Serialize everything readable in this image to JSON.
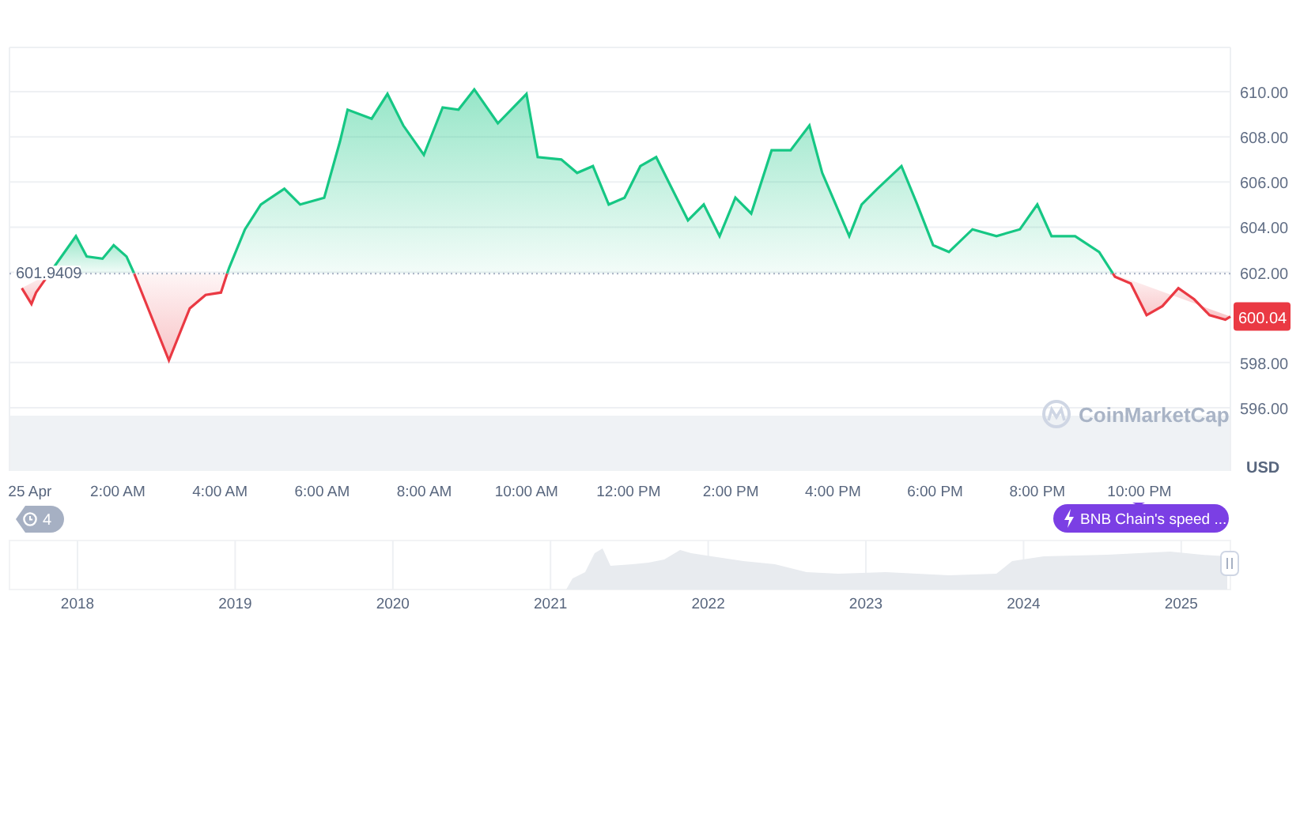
{
  "chart": {
    "chart_data": {
      "type": "area",
      "grid": true,
      "xlim": [
        -0.12,
        23.78
      ],
      "ylim": [
        593.2,
        611.96
      ],
      "x": [
        0.12,
        0.31,
        0.4,
        0.66,
        1.18,
        1.39,
        1.7,
        1.92,
        2.17,
        2.32,
        2.63,
        3.0,
        3.41,
        3.72,
        4.02,
        4.14,
        4.18,
        4.49,
        4.8,
        5.26,
        5.57,
        6.04,
        6.35,
        6.5,
        6.97,
        7.28,
        7.59,
        7.99,
        8.36,
        8.67,
        8.98,
        9.44,
        10.0,
        10.22,
        10.68,
        10.99,
        11.3,
        11.61,
        11.92,
        12.23,
        12.54,
        12.85,
        13.16,
        13.47,
        13.78,
        14.09,
        14.4,
        14.8,
        15.17,
        15.54,
        15.79,
        16.32,
        16.56,
        16.87,
        17.34,
        17.65,
        17.96,
        18.27,
        18.73,
        19.2,
        19.66,
        20.0,
        20.28,
        20.74,
        21.21,
        21.48,
        21.52,
        21.83,
        22.14,
        22.45,
        22.76,
        23.07,
        23.37,
        23.68,
        23.78
      ],
      "series": [
        {
          "color": "#16c784",
          "values": [
            null,
            null,
            null,
            601.94,
            603.6,
            602.7,
            602.6,
            603.2,
            602.7,
            601.95,
            null,
            null,
            null,
            null,
            null,
            601.94,
            602.2,
            603.9,
            605.0,
            605.7,
            605.0,
            605.3,
            607.8,
            609.2,
            608.8,
            609.9,
            608.5,
            607.2,
            609.3,
            609.2,
            610.1,
            608.6,
            609.9,
            607.1,
            607.0,
            606.4,
            606.7,
            605.0,
            605.3,
            606.7,
            607.1,
            605.7,
            604.3,
            605.0,
            603.6,
            605.3,
            604.6,
            607.4,
            607.4,
            608.5,
            606.4,
            603.6,
            605.0,
            605.7,
            606.7,
            605.0,
            603.2,
            602.9,
            603.9,
            603.6,
            603.9,
            605.0,
            603.6,
            603.6,
            602.9,
            601.94,
            null,
            null,
            null,
            null,
            null,
            null,
            null,
            null,
            null
          ]
        },
        {
          "color": "#ea3943",
          "values": [
            601.3,
            600.6,
            601.1,
            601.94,
            null,
            null,
            null,
            null,
            null,
            601.95,
            600.2,
            598.1,
            600.4,
            601.0,
            601.1,
            601.94,
            null,
            null,
            null,
            null,
            null,
            null,
            null,
            null,
            null,
            null,
            null,
            null,
            null,
            null,
            null,
            null,
            null,
            null,
            null,
            null,
            null,
            null,
            null,
            null,
            null,
            null,
            null,
            null,
            null,
            null,
            null,
            null,
            null,
            null,
            null,
            null,
            null,
            null,
            null,
            null,
            null,
            null,
            null,
            null,
            null,
            null,
            null,
            null,
            null,
            601.94,
            601.8,
            601.5,
            600.1,
            600.5,
            601.3,
            600.8,
            600.1,
            599.9,
            600.04
          ]
        }
      ],
      "ref_lines": [
        {
          "axis": "y",
          "value": 601.9409,
          "label": "601.9409"
        }
      ],
      "yticks": [
        {
          "value": 596,
          "label": "596.00"
        },
        {
          "value": 598,
          "label": "598.00"
        },
        {
          "value": 602,
          "label": "602.00"
        },
        {
          "value": 604,
          "label": "604.00"
        },
        {
          "value": 606,
          "label": "606.00"
        },
        {
          "value": 608,
          "label": "608.00"
        },
        {
          "value": 610,
          "label": "610.00"
        }
      ],
      "xticks": [
        {
          "value": 0.28,
          "label": "25 Apr"
        },
        {
          "value": 2,
          "label": "2:00 AM"
        },
        {
          "value": 4,
          "label": "4:00 AM"
        },
        {
          "value": 6,
          "label": "6:00 AM"
        },
        {
          "value": 8,
          "label": "8:00 AM"
        },
        {
          "value": 10,
          "label": "10:00 AM"
        },
        {
          "value": 12,
          "label": "12:00 PM"
        },
        {
          "value": 14,
          "label": "2:00 PM"
        },
        {
          "value": 16,
          "label": "4:00 PM"
        },
        {
          "value": 18,
          "label": "6:00 PM"
        },
        {
          "value": 20,
          "label": "8:00 PM"
        },
        {
          "value": 22,
          "label": "10:00 PM"
        }
      ]
    },
    "price_tag": "600.04",
    "currency": "USD",
    "watermark": "CoinMarketCap",
    "history_count": "4",
    "news": "BNB Chain's speed ..."
  },
  "navigator": {
    "years": [
      "2018",
      "2019",
      "2020",
      "2021",
      "2022",
      "2023",
      "2024",
      "2025"
    ]
  }
}
